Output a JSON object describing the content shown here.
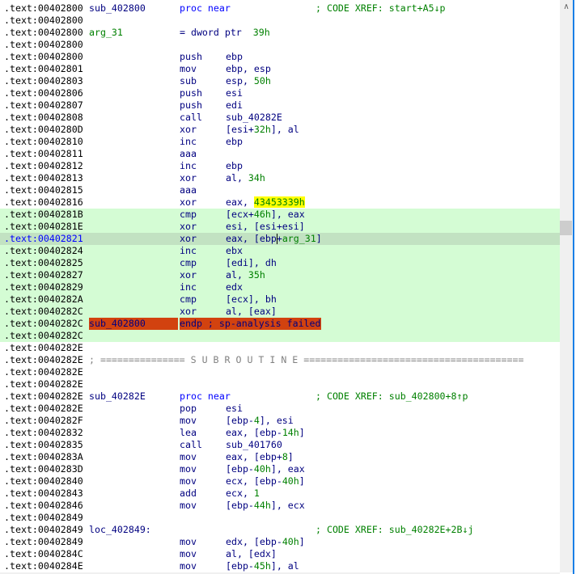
{
  "colors": {
    "selection_green": "#d4fcd4",
    "current_line": "#c2e2c2",
    "error_red": "#d2420f",
    "highlight_yellow": "#ffff00",
    "number_green": "#008000",
    "code_navy": "#000080"
  },
  "scrollbar": {
    "up_icon": "chevron-up-icon",
    "position_fraction": 0.39
  },
  "lines": [
    {
      "addr": ".text:00402800",
      "label": "sub_402800",
      "mn": "proc near",
      "cmt": "; CODE XREF: start+A5↓p"
    },
    {
      "addr": ".text:00402800"
    },
    {
      "addr": ".text:00402800",
      "label": "arg_31",
      "labelType": "var",
      "mn": "= dword ptr  39h"
    },
    {
      "addr": ".text:00402800"
    },
    {
      "addr": ".text:00402800",
      "mn": "push",
      "ops": "ebp"
    },
    {
      "addr": ".text:00402801",
      "mn": "mov",
      "ops": "ebp, esp"
    },
    {
      "addr": ".text:00402803",
      "mn": "sub",
      "ops": "esp, 50h"
    },
    {
      "addr": ".text:00402806",
      "mn": "push",
      "ops": "esi"
    },
    {
      "addr": ".text:00402807",
      "mn": "push",
      "ops": "edi"
    },
    {
      "addr": ".text:00402808",
      "mn": "call",
      "ops": "sub_40282E"
    },
    {
      "addr": ".text:0040280D",
      "mn": "xor",
      "ops": "[esi+32h], al"
    },
    {
      "addr": ".text:00402810",
      "mn": "inc",
      "ops": "ebp"
    },
    {
      "addr": ".text:00402811",
      "mn": "aaa"
    },
    {
      "addr": ".text:00402812",
      "mn": "inc",
      "ops": "ebp"
    },
    {
      "addr": ".text:00402813",
      "mn": "xor",
      "ops": "al, 34h"
    },
    {
      "addr": ".text:00402815",
      "mn": "aaa"
    },
    {
      "addr": ".text:00402816",
      "mn": "xor",
      "ops": "eax, 43453339h",
      "highlight": "43453339h"
    },
    {
      "addr": ".text:0040281B",
      "mn": "cmp",
      "ops": "[ecx+46h], eax",
      "bg": "green"
    },
    {
      "addr": ".text:0040281E",
      "mn": "xor",
      "ops": "esi, [esi+esi]",
      "bg": "green"
    },
    {
      "addr": ".text:00402821",
      "mn": "xor",
      "ops": "eax, [ebp+arg_31]",
      "bg": "cur"
    },
    {
      "addr": ".text:00402824",
      "mn": "inc",
      "ops": "ebx",
      "bg": "green"
    },
    {
      "addr": ".text:00402825",
      "mn": "cmp",
      "ops": "[edi], dh",
      "bg": "green"
    },
    {
      "addr": ".text:00402827",
      "mn": "xor",
      "ops": "al, 35h",
      "bg": "green"
    },
    {
      "addr": ".text:00402829",
      "mn": "inc",
      "ops": "edx",
      "bg": "green"
    },
    {
      "addr": ".text:0040282A",
      "mn": "cmp",
      "ops": "[ecx], bh",
      "bg": "green"
    },
    {
      "addr": ".text:0040282C",
      "mn": "xor",
      "ops": "al, [eax]",
      "bg": "green"
    },
    {
      "addr": ".text:0040282C",
      "label": "sub_402800",
      "labelType": "err",
      "mn": "endp ; sp-analysis failed",
      "bg": "green"
    },
    {
      "addr": ".text:0040282C",
      "bg": "green"
    },
    {
      "addr": ".text:0040282E"
    },
    {
      "addr": ".text:0040282E",
      "sep": "; =============== S U B R O U T I N E ======================================="
    },
    {
      "addr": ".text:0040282E"
    },
    {
      "addr": ".text:0040282E"
    },
    {
      "addr": ".text:0040282E",
      "label": "sub_40282E",
      "mn": "proc near",
      "cmt": "; CODE XREF: sub_402800+8↑p"
    },
    {
      "addr": ".text:0040282E",
      "mn": "pop",
      "ops": "esi"
    },
    {
      "addr": ".text:0040282F",
      "mn": "mov",
      "ops": "[ebp-4], esi"
    },
    {
      "addr": ".text:00402832",
      "mn": "lea",
      "ops": "eax, [ebp-14h]"
    },
    {
      "addr": ".text:00402835",
      "mn": "call",
      "ops": "sub_401760"
    },
    {
      "addr": ".text:0040283A",
      "mn": "mov",
      "ops": "eax, [ebp+8]"
    },
    {
      "addr": ".text:0040283D",
      "mn": "mov",
      "ops": "[ebp-40h], eax"
    },
    {
      "addr": ".text:00402840",
      "mn": "mov",
      "ops": "ecx, [ebp-40h]"
    },
    {
      "addr": ".text:00402843",
      "mn": "add",
      "ops": "ecx, 1"
    },
    {
      "addr": ".text:00402846",
      "mn": "mov",
      "ops": "[ebp-44h], ecx"
    },
    {
      "addr": ".text:00402849"
    },
    {
      "addr": ".text:00402849",
      "label": "loc_402849:",
      "cmt": "; CODE XREF: sub_40282E+2B↓j"
    },
    {
      "addr": ".text:00402849",
      "mn": "mov",
      "ops": "edx, [ebp-40h]"
    },
    {
      "addr": ".text:0040284C",
      "mn": "mov",
      "ops": "al, [edx]"
    },
    {
      "addr": ".text:0040284E",
      "mn": "mov",
      "ops": "[ebp-45h], al"
    }
  ]
}
